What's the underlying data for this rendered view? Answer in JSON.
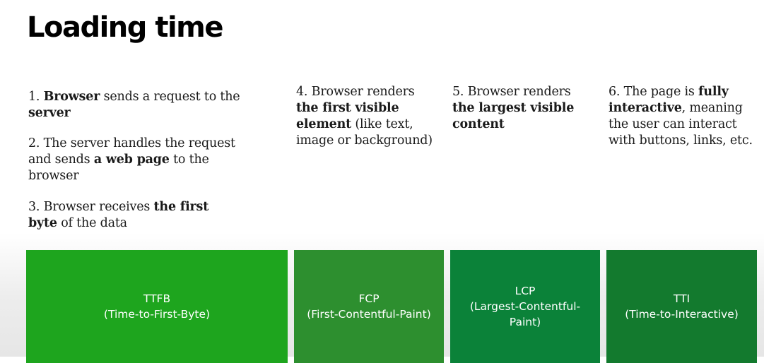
{
  "title": "Loading time",
  "steps": [
    {
      "parts": [
        {
          "text": "1. ",
          "bold": false
        },
        {
          "text": "Browser",
          "bold": true
        },
        {
          "text": " sends a request to the ",
          "bold": false
        },
        {
          "text": "server",
          "bold": true
        }
      ]
    },
    {
      "parts": [
        {
          "text": "2. The server handles the request and sends ",
          "bold": false
        },
        {
          "text": "a web page",
          "bold": true
        },
        {
          "text": " to the browser",
          "bold": false
        }
      ]
    },
    {
      "parts": [
        {
          "text": "3. Browser receives ",
          "bold": false
        },
        {
          "text": "the first byte",
          "bold": true
        },
        {
          "text": " of the data",
          "bold": false
        }
      ]
    },
    {
      "parts": [
        {
          "text": "4. Browser renders ",
          "bold": false
        },
        {
          "text": "the first visible element",
          "bold": true
        },
        {
          "text": " (like text, image or background)",
          "bold": false
        }
      ]
    },
    {
      "parts": [
        {
          "text": "5. Browser renders ",
          "bold": false
        },
        {
          "text": "the largest visible content",
          "bold": true
        }
      ]
    },
    {
      "parts": [
        {
          "text": "6. The page is ",
          "bold": false
        },
        {
          "text": "fully interactive",
          "bold": true
        },
        {
          "text": ", meaning the user can interact with buttons, links, etc.",
          "bold": false
        }
      ]
    }
  ],
  "metrics": [
    {
      "abbr": "TTFB",
      "full": "(Time-to-First-Byte)",
      "color": "#1ea51e"
    },
    {
      "abbr": "FCP",
      "full": "(First-Contentful-Paint)",
      "color": "#2d8f2f"
    },
    {
      "abbr": "LCP",
      "full": "(Largest-Contentful-Paint)",
      "color": "#0b8239"
    },
    {
      "abbr": "TTI",
      "full": "(Time-to-Interactive)",
      "color": "#137a2e"
    }
  ]
}
